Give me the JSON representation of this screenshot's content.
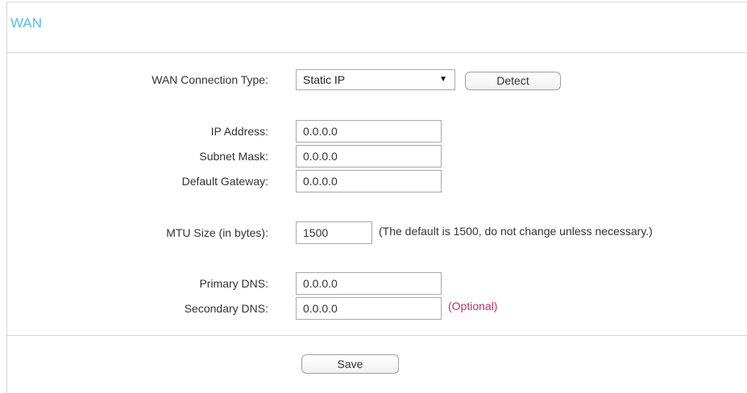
{
  "panel": {
    "title": "WAN"
  },
  "connection": {
    "label": "WAN Connection Type:",
    "selected": "Static IP",
    "detect_label": "Detect"
  },
  "fields": {
    "ip_address": {
      "label": "IP Address:",
      "value": "0.0.0.0"
    },
    "subnet_mask": {
      "label": "Subnet Mask:",
      "value": "0.0.0.0"
    },
    "default_gateway": {
      "label": "Default Gateway:",
      "value": "0.0.0.0"
    },
    "mtu": {
      "label": "MTU Size (in bytes):",
      "value": "1500",
      "hint": "(The default is 1500, do not change unless necessary.)"
    },
    "primary_dns": {
      "label": "Primary DNS:",
      "value": "0.0.0.0"
    },
    "secondary_dns": {
      "label": "Secondary DNS:",
      "value": "0.0.0.0",
      "hint": "(Optional)"
    }
  },
  "footer": {
    "save_label": "Save"
  },
  "colors": {
    "title": "#4fc3d9",
    "optional_hint": "#c0306a",
    "border": "#d6d6d6"
  },
  "icons": {
    "select_arrow": "triangle-down-icon"
  }
}
